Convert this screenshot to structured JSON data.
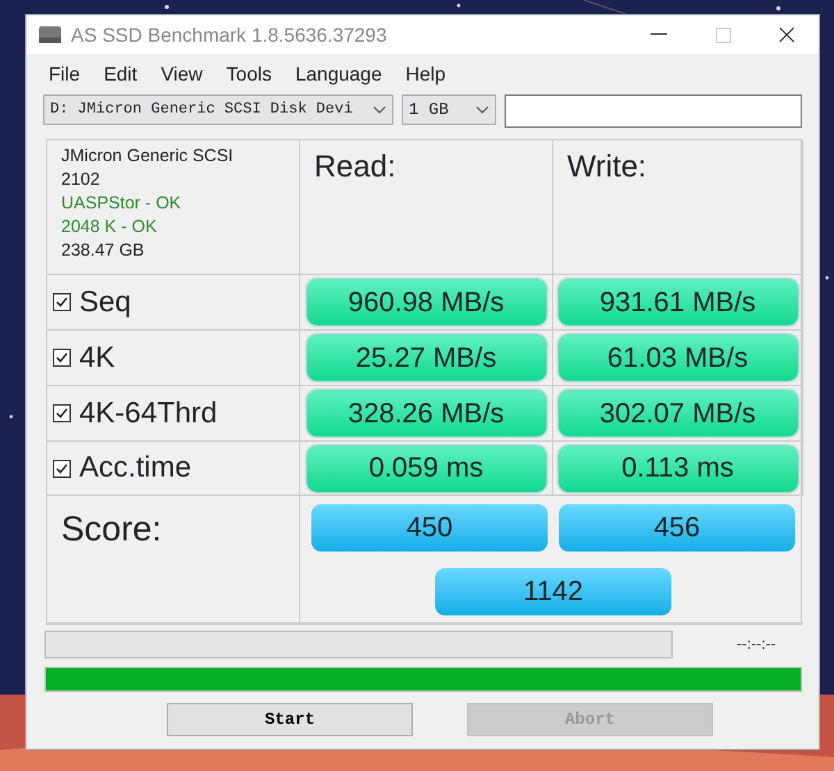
{
  "window": {
    "title": "AS SSD Benchmark 1.8.5636.37293"
  },
  "menu": [
    "File",
    "Edit",
    "View",
    "Tools",
    "Language",
    "Help"
  ],
  "toolbar": {
    "drive": "D: JMicron Generic SCSI Disk Devi",
    "size": "1 GB"
  },
  "drive_info": [
    {
      "text": "JMicron Generic SCSI",
      "ok": false
    },
    {
      "text": "2102",
      "ok": false
    },
    {
      "text": "UASPStor - OK",
      "ok": true
    },
    {
      "text": "2048 K - OK",
      "ok": true
    },
    {
      "text": "238.47 GB",
      "ok": false
    }
  ],
  "columns": [
    "Read:",
    "Write:"
  ],
  "tests": [
    {
      "label": "Seq",
      "checked": true,
      "read": "960.98 MB/s",
      "write": "931.61 MB/s"
    },
    {
      "label": "4K",
      "checked": true,
      "read": "25.27 MB/s",
      "write": "61.03 MB/s"
    },
    {
      "label": "4K-64Thrd",
      "checked": true,
      "read": "328.26 MB/s",
      "write": "302.07 MB/s"
    },
    {
      "label": "Acc.time",
      "checked": true,
      "read": "0.059 ms",
      "write": "0.113 ms"
    }
  ],
  "score": {
    "label": "Score:",
    "read": "450",
    "write": "456",
    "total": "1142"
  },
  "progress": {
    "level": 0,
    "time": "--:--:--"
  },
  "total_progress": {
    "level": 1
  },
  "buttons": [
    {
      "label": "Start",
      "disabled": false
    },
    {
      "label": "Abort",
      "disabled": true
    }
  ]
}
